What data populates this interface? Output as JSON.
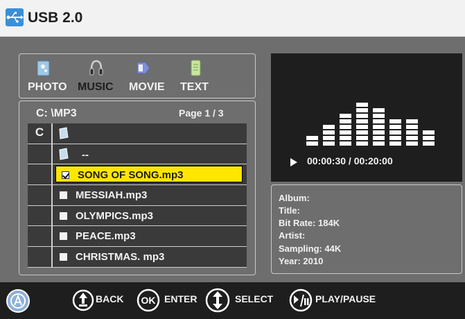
{
  "header": {
    "title": "USB 2.0",
    "icon": "usb-icon"
  },
  "categories": [
    {
      "label": "PHOTO",
      "icon": "photo-icon",
      "active": false
    },
    {
      "label": "MUSIC",
      "icon": "music-icon",
      "active": true
    },
    {
      "label": "MOVIE",
      "icon": "movie-icon",
      "active": false
    },
    {
      "label": "TEXT",
      "icon": "text-icon",
      "active": false
    }
  ],
  "browser": {
    "path": "C:   \\MP3",
    "page": "Page 1 / 3",
    "rows": [
      {
        "letter": "C",
        "type": "folder",
        "name": ""
      },
      {
        "letter": "",
        "type": "parent",
        "name": "--"
      },
      {
        "letter": "",
        "type": "file",
        "name": "SONG OF SONG.mp3",
        "checked": true,
        "selected": true
      },
      {
        "letter": "",
        "type": "file",
        "name": "MESSIAH.mp3",
        "checked": false,
        "selected": false
      },
      {
        "letter": "",
        "type": "file",
        "name": "OLYMPICS.mp3",
        "checked": false,
        "selected": false
      },
      {
        "letter": "",
        "type": "file",
        "name": "PEACE.mp3",
        "checked": false,
        "selected": false
      },
      {
        "letter": "",
        "type": "file",
        "name": "CHRISTMAS. mp3",
        "checked": false,
        "selected": false
      }
    ]
  },
  "player": {
    "elapsed": "00:00:30",
    "total": "00:20:00",
    "time_display": "00:00:30  /  00:20:00",
    "equalizer_levels": [
      2,
      4,
      6,
      8,
      7,
      5,
      5,
      3
    ]
  },
  "info": {
    "album": "Album:",
    "title": "Title:",
    "bitrate": "Bit Rate:  184K",
    "artist": "Artist:",
    "sampling": "Sampling: 44K",
    "year": "Year: 2010"
  },
  "footer": {
    "back": "BACK",
    "ok_icon_text": "OK",
    "enter": "ENTER",
    "select": "SELECT",
    "playpause": "PLAY/PAUSE"
  },
  "colors": {
    "background": "#6e6e6e",
    "selection": "#ffe600",
    "dark_panel": "#1e1e1e",
    "accent_blue": "#3b8fd6"
  }
}
